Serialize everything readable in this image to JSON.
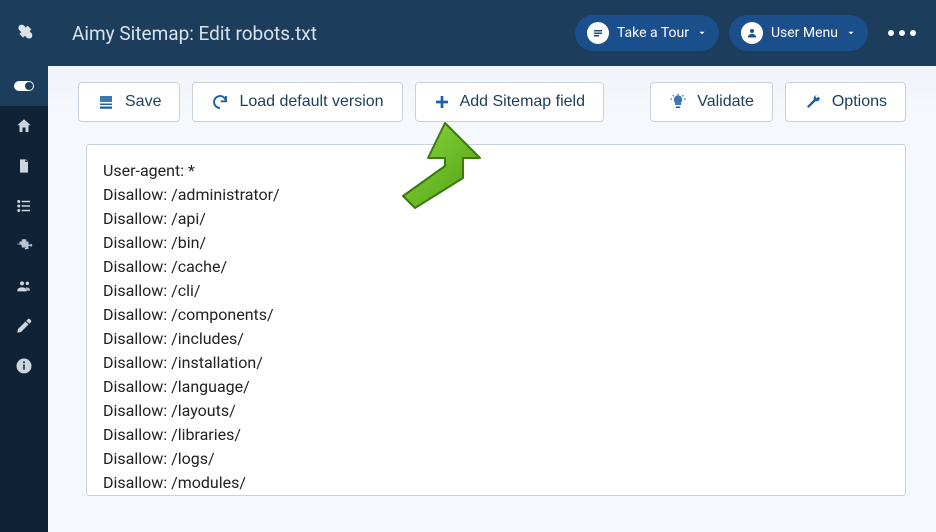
{
  "header": {
    "title": "Aimy Sitemap: Edit robots.txt",
    "tour_label": "Take a Tour",
    "user_menu_label": "User Menu"
  },
  "toolbar": {
    "save_label": "Save",
    "load_default_label": "Load default version",
    "add_sitemap_label": "Add Sitemap field",
    "validate_label": "Validate",
    "options_label": "Options"
  },
  "editor": {
    "content": "User-agent: *\nDisallow: /administrator/\nDisallow: /api/\nDisallow: /bin/\nDisallow: /cache/\nDisallow: /cli/\nDisallow: /components/\nDisallow: /includes/\nDisallow: /installation/\nDisallow: /language/\nDisallow: /layouts/\nDisallow: /libraries/\nDisallow: /logs/\nDisallow: /modules/\n"
  }
}
